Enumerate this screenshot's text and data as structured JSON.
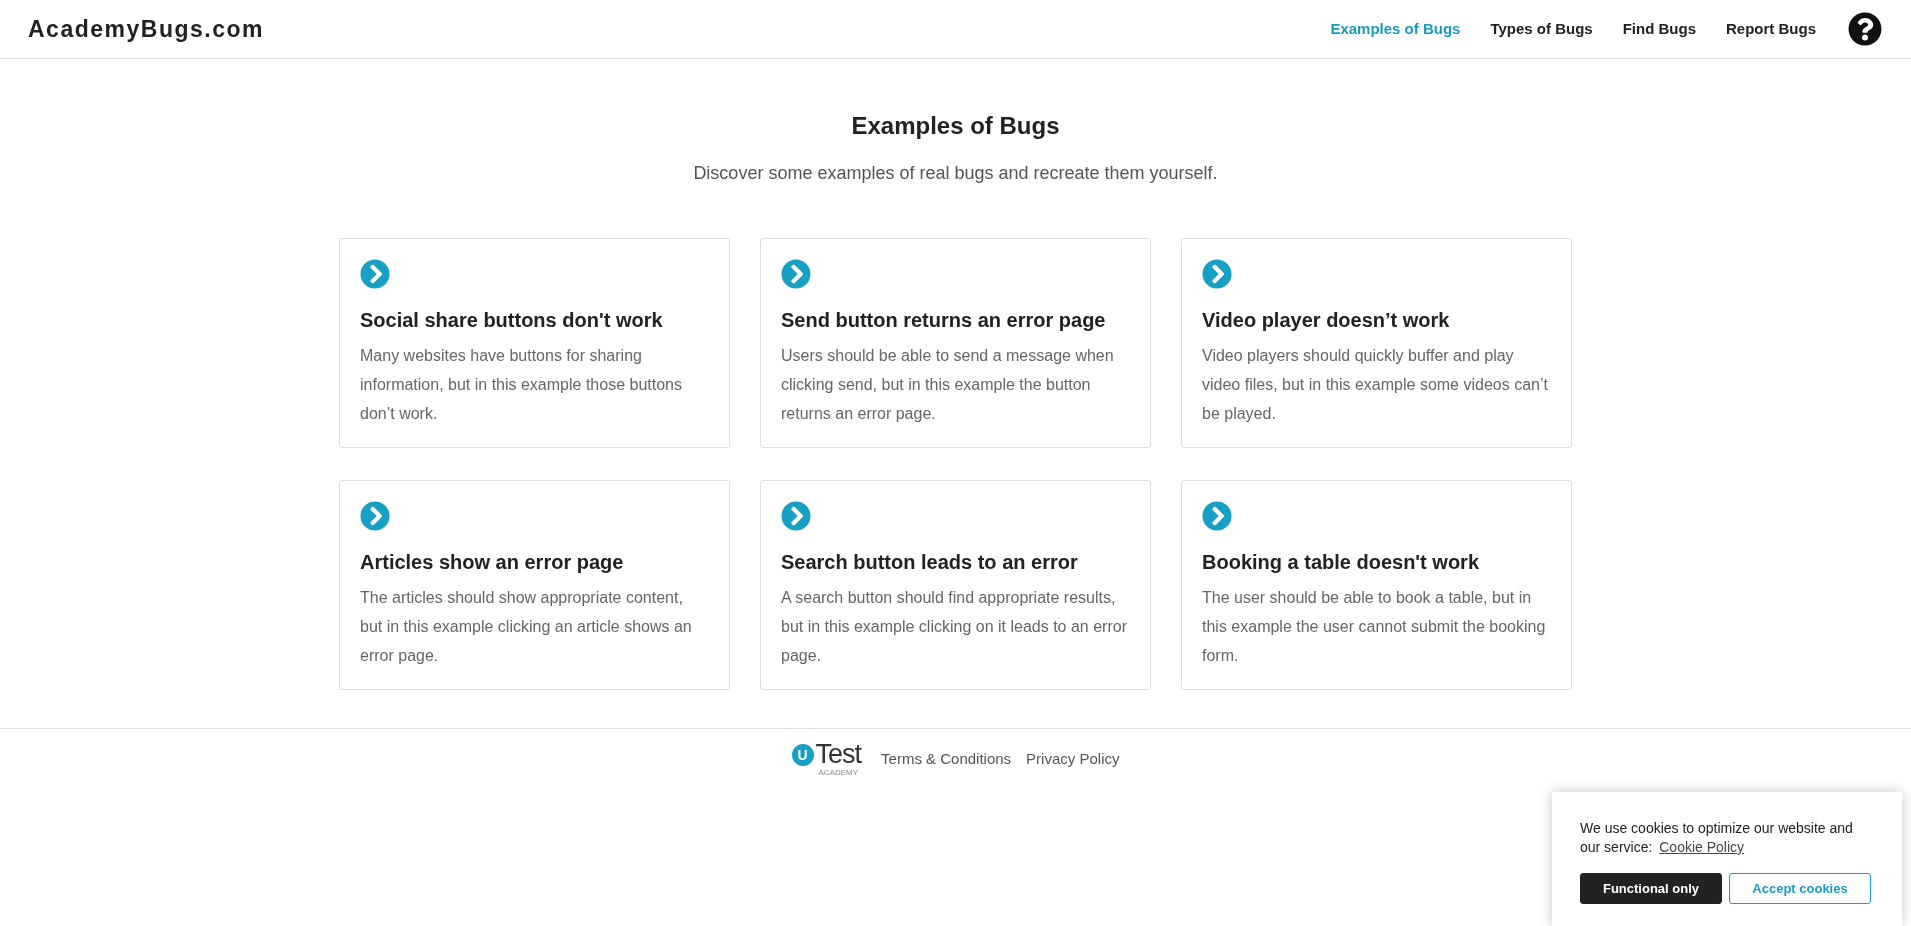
{
  "header": {
    "logo": "AcademyBugs.com",
    "nav": [
      {
        "label": "Examples of Bugs",
        "selected": true
      },
      {
        "label": "Types of Bugs",
        "selected": false
      },
      {
        "label": "Find Bugs",
        "selected": false
      },
      {
        "label": "Report Bugs",
        "selected": false
      }
    ]
  },
  "intro": {
    "title": "Examples of Bugs",
    "subtitle": "Discover some examples of real bugs and recreate them yourself."
  },
  "cards": [
    {
      "title": "Social share buttons don't work",
      "description": "Many websites have buttons for sharing information, but in this example those buttons don’t work."
    },
    {
      "title": "Send button returns an error page",
      "description": "Users should be able to send a message when clicking send, but in this example the button returns an error page."
    },
    {
      "title": "Video player doesn’t work",
      "description": "Video players should quickly buffer and play video files, but in this example some videos can’t be played."
    },
    {
      "title": "Articles show an error page",
      "description": "The articles should show appropriate content, but in this example clicking an article shows an error page."
    },
    {
      "title": "Search button leads to an error",
      "description": "A search button should find appropriate results, but in this example clicking on it leads to an error page."
    },
    {
      "title": "Booking a table doesn't work",
      "description": "The user should be able to book a table, but in this example the user cannot submit the booking form."
    }
  ],
  "footer": {
    "logo": {
      "mark": "U",
      "word": "Test",
      "tagline": "ACADEMY"
    },
    "links": [
      "Terms & Conditions",
      "Privacy Policy"
    ]
  },
  "cookie_banner": {
    "text": "We use cookies to optimize our website and our service:",
    "link": "Cookie Policy",
    "buttons": [
      {
        "label": "Functional only",
        "kind": "filled"
      },
      {
        "label": "Accept cookies",
        "kind": "outlined"
      }
    ]
  }
}
